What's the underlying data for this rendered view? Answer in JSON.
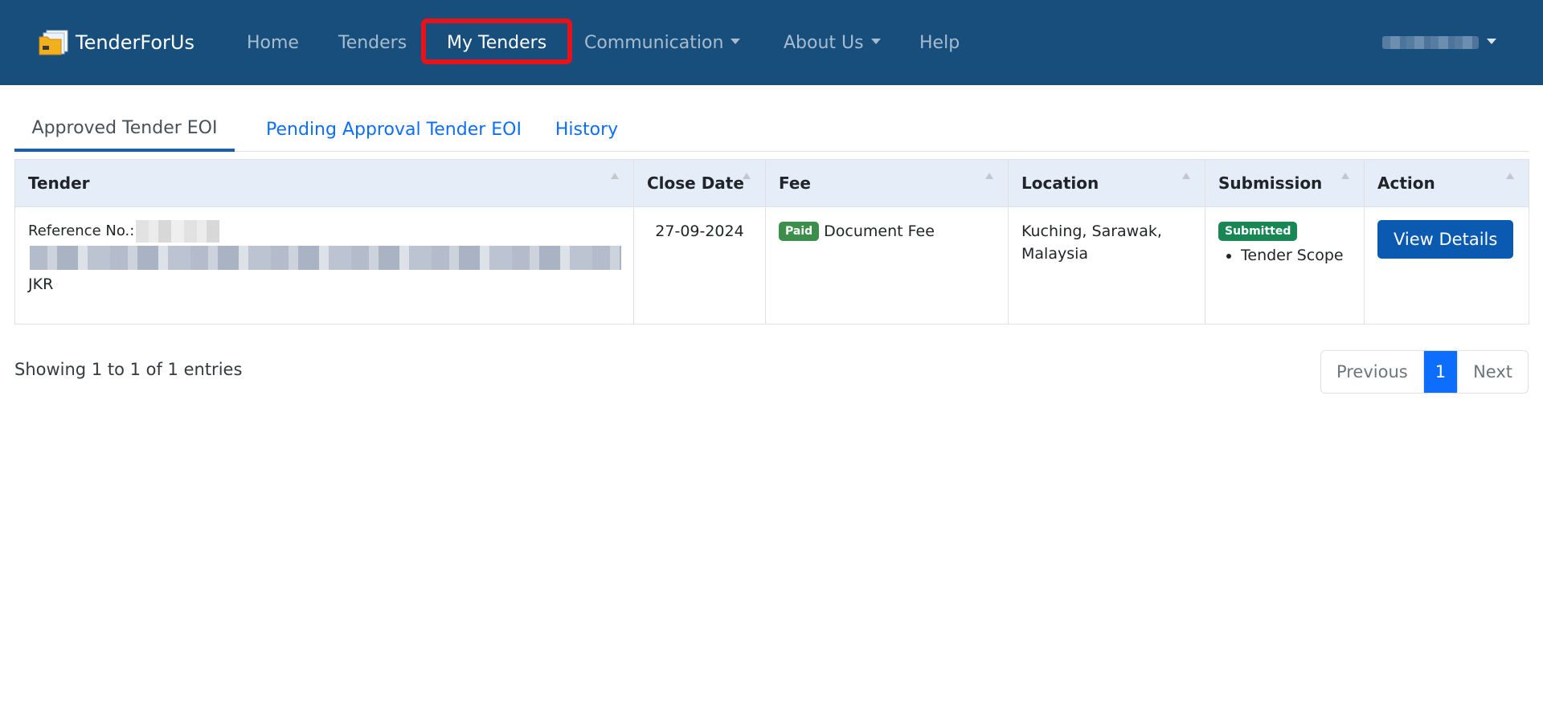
{
  "brand": {
    "name": "TenderForUs"
  },
  "nav": {
    "home": "Home",
    "tenders": "Tenders",
    "my_tenders": "My Tenders",
    "communication": "Communication",
    "about_us": "About Us",
    "help": "Help"
  },
  "tabs": {
    "approved": "Approved Tender EOI",
    "pending": "Pending Approval Tender EOI",
    "history": "History"
  },
  "table": {
    "headers": {
      "tender": "Tender",
      "close_date": "Close Date",
      "fee": "Fee",
      "location": "Location",
      "submission": "Submission",
      "action": "Action"
    },
    "rows": [
      {
        "reference_label": "Reference No.:",
        "agency": "JKR",
        "close_date": "27-09-2024",
        "fee_badge": "Paid",
        "fee_text": "Document Fee",
        "location": "Kuching, Sarawak, Malaysia",
        "submission_badge": "Submitted",
        "submission_item": "Tender Scope",
        "action_label": "View Details"
      }
    ]
  },
  "footer": {
    "info": "Showing 1 to 1 of 1 entries",
    "previous": "Previous",
    "page": "1",
    "next": "Next"
  },
  "colors": {
    "navbar": "#174e7c",
    "highlight": "#e8121a",
    "primary": "#0d6efd",
    "paid_badge": "#3c8f4a",
    "submitted_badge": "#198754"
  }
}
